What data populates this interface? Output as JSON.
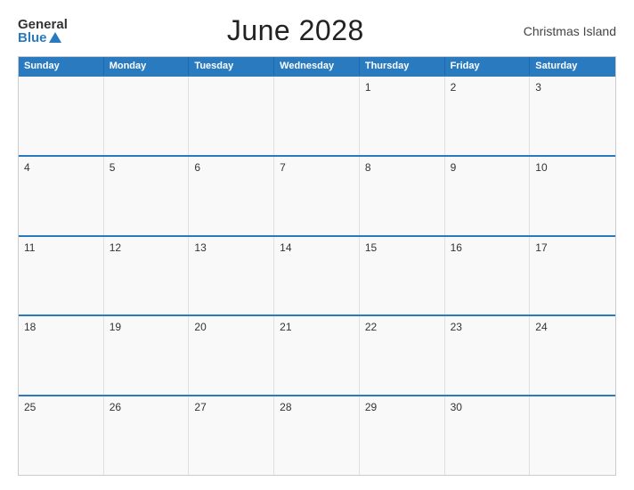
{
  "header": {
    "logo_general": "General",
    "logo_blue": "Blue",
    "title": "June 2028",
    "region": "Christmas Island"
  },
  "calendar": {
    "days": [
      "Sunday",
      "Monday",
      "Tuesday",
      "Wednesday",
      "Thursday",
      "Friday",
      "Saturday"
    ],
    "weeks": [
      [
        {
          "date": "",
          "empty": true
        },
        {
          "date": "",
          "empty": true
        },
        {
          "date": "",
          "empty": true
        },
        {
          "date": "",
          "empty": true
        },
        {
          "date": "1",
          "empty": false
        },
        {
          "date": "2",
          "empty": false
        },
        {
          "date": "3",
          "empty": false
        }
      ],
      [
        {
          "date": "4",
          "empty": false
        },
        {
          "date": "5",
          "empty": false
        },
        {
          "date": "6",
          "empty": false
        },
        {
          "date": "7",
          "empty": false
        },
        {
          "date": "8",
          "empty": false
        },
        {
          "date": "9",
          "empty": false
        },
        {
          "date": "10",
          "empty": false
        }
      ],
      [
        {
          "date": "11",
          "empty": false
        },
        {
          "date": "12",
          "empty": false
        },
        {
          "date": "13",
          "empty": false
        },
        {
          "date": "14",
          "empty": false
        },
        {
          "date": "15",
          "empty": false
        },
        {
          "date": "16",
          "empty": false
        },
        {
          "date": "17",
          "empty": false
        }
      ],
      [
        {
          "date": "18",
          "empty": false
        },
        {
          "date": "19",
          "empty": false
        },
        {
          "date": "20",
          "empty": false
        },
        {
          "date": "21",
          "empty": false
        },
        {
          "date": "22",
          "empty": false
        },
        {
          "date": "23",
          "empty": false
        },
        {
          "date": "24",
          "empty": false
        }
      ],
      [
        {
          "date": "25",
          "empty": false
        },
        {
          "date": "26",
          "empty": false
        },
        {
          "date": "27",
          "empty": false
        },
        {
          "date": "28",
          "empty": false
        },
        {
          "date": "29",
          "empty": false
        },
        {
          "date": "30",
          "empty": false
        },
        {
          "date": "",
          "empty": true
        }
      ]
    ]
  }
}
